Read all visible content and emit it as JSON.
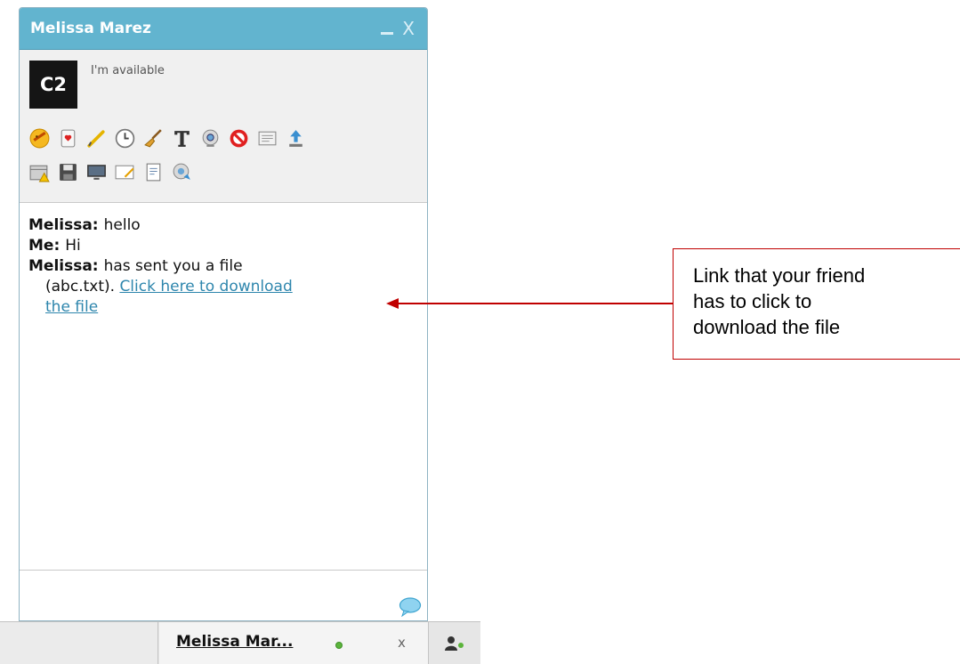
{
  "window": {
    "title": "Melissa Marez",
    "minimize": "_",
    "close": "X"
  },
  "profile": {
    "avatar_text": "C2",
    "status": "I'm available"
  },
  "toolbar": {
    "row1": [
      "emoticon-icon",
      "card-icon",
      "pen-icon",
      "clock-icon",
      "broom-icon",
      "text-format-icon",
      "webcam-icon",
      "block-icon",
      "notes-icon",
      "upload-icon"
    ],
    "row2": [
      "calendar-warning-icon",
      "save-icon",
      "screen-share-icon",
      "whiteboard-icon",
      "document-icon",
      "video-call-icon"
    ]
  },
  "messages": [
    {
      "sender": "Melissa:",
      "text": "hello"
    },
    {
      "sender": "Me:",
      "text": "Hi"
    },
    {
      "sender": "Melissa:",
      "text": "has sent you a file",
      "file_prefix": "(abc.txt).",
      "link_line1": "Click here to download",
      "link_line2": "the file"
    }
  ],
  "taskbar": {
    "tab_name": "Melissa Mar...",
    "tab_close": "x",
    "online_color": "#5bb43b"
  },
  "callout": {
    "line1": "Link that your friend",
    "line2": "has to click to",
    "line3": "download the file",
    "color": "#c00000"
  },
  "colors": {
    "titlebar": "#62b4cf",
    "link": "#2e86ad"
  }
}
